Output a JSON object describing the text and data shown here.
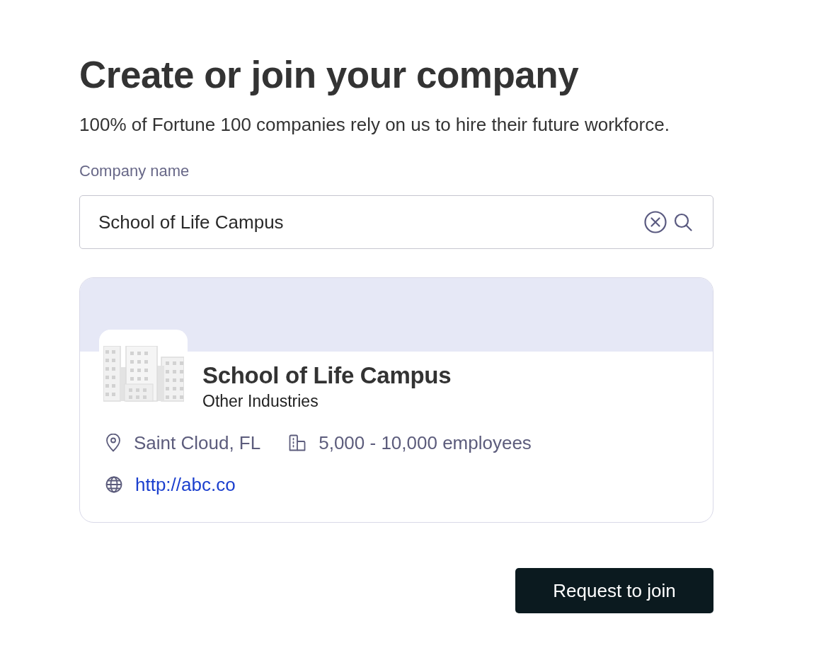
{
  "page": {
    "title": "Create or join your company",
    "subtitle": "100% of Fortune 100 companies rely on us to hire their future workforce."
  },
  "company_field": {
    "label": "Company name",
    "value": "School of Life Campus"
  },
  "result_card": {
    "name": "School of Life Campus",
    "industry": "Other Industries",
    "detail_rows": [
      [
        {
          "kind": "location",
          "text": "Saint Cloud, FL"
        },
        {
          "kind": "size",
          "text": "5,000 - 10,000 employees"
        }
      ],
      [
        {
          "kind": "website",
          "text": "http://abc.co"
        }
      ]
    ]
  },
  "buttons": [
    {
      "label": "Request to join"
    }
  ]
}
